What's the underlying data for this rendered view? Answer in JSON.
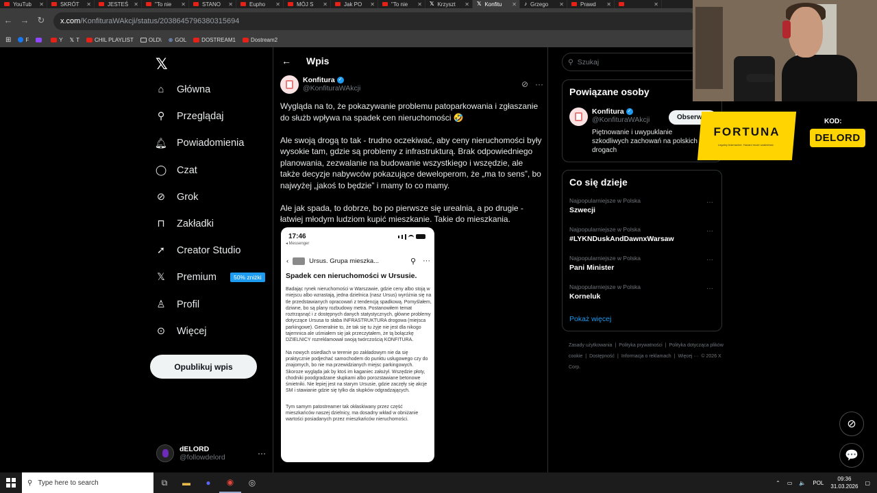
{
  "browser": {
    "tabs": [
      {
        "label": "YouTub",
        "icon": "youtube"
      },
      {
        "label": "SKRÓT",
        "icon": "youtube"
      },
      {
        "label": "JESTEŚ",
        "icon": "youtube"
      },
      {
        "label": "\"To nie",
        "icon": "youtube"
      },
      {
        "label": "STANO",
        "icon": "youtube"
      },
      {
        "label": "Eupho",
        "icon": "youtube"
      },
      {
        "label": "MÓJ S",
        "icon": "youtube"
      },
      {
        "label": "Jak PO",
        "icon": "youtube"
      },
      {
        "label": "\"To nie",
        "icon": "youtube"
      },
      {
        "label": "Krzyszt",
        "icon": "x"
      },
      {
        "label": "Konfitu",
        "icon": "x",
        "active": true
      },
      {
        "label": "Grzego",
        "icon": "tiktok"
      },
      {
        "label": "Prawd",
        "icon": "youtube"
      },
      {
        "label": "",
        "icon": "youtube"
      }
    ],
    "url_host": "x.com",
    "url_path": "/KonfituraWAkcji/status/2038645796380315694",
    "bookmarks": [
      {
        "label": "F",
        "icon": "facebook"
      },
      {
        "label": "",
        "icon": "twitch"
      },
      {
        "label": "Y",
        "icon": "youtube"
      },
      {
        "label": "T",
        "icon": "x"
      },
      {
        "label": "CHIL PLAYLIST",
        "icon": "youtube"
      },
      {
        "label": "OLD\\",
        "icon": "folder"
      },
      {
        "label": "GOL",
        "icon": "globe"
      },
      {
        "label": "DOSTREAM1",
        "icon": "youtube"
      },
      {
        "label": "Dostream2",
        "icon": "youtube"
      }
    ]
  },
  "sidebar": {
    "items": [
      {
        "label": "Główna",
        "icon": "home-icon"
      },
      {
        "label": "Przeglądaj",
        "icon": "search-icon"
      },
      {
        "label": "Powiadomienia",
        "icon": "bell-icon"
      },
      {
        "label": "Czat",
        "icon": "chat-icon"
      },
      {
        "label": "Grok",
        "icon": "grok-icon"
      },
      {
        "label": "Zakładki",
        "icon": "bookmark-icon"
      },
      {
        "label": "Creator Studio",
        "icon": "rocket-icon"
      },
      {
        "label": "Premium",
        "icon": "x-icon"
      },
      {
        "label": "Profil",
        "icon": "person-icon"
      },
      {
        "label": "Więcej",
        "icon": "more-icon"
      }
    ],
    "premium_badge": "50% zniżki",
    "post_button": "Opublikuj wpis",
    "account": {
      "name": "dELORD",
      "handle": "@followdelord"
    }
  },
  "main": {
    "header_title": "Wpis",
    "author_name": "Konfitura",
    "author_handle": "@KonfituraWAkcji",
    "paragraphs": [
      "Wygląda na to, że pokazywanie problemu patoparkowania i zgłaszanie do służb wpływa na spadek cen nieruchomości 🤣",
      "Ale swoją drogą to tak - trudno oczekiwać, aby ceny nieruchomości były wysokie tam, gdzie są problemy z infrastrukturą. Brak odpowiedniego planowania, zezwalanie na budowanie wszystkiego i wszędzie, ale także decyzje nabywców pokazujące deweloperom, że „ma to sens”, bo najwyżej „jakoś to będzie” i mamy to co mamy.",
      "Ale jak spada, to dobrze, bo po pierwsze się urealnia, a po drugie - łatwiej młodym ludziom kupić mieszkanie. Takie do mieszkania."
    ],
    "screenshot": {
      "time": "17:46",
      "back_app": "◂ Messenger",
      "group_name": "Ursus. Grupa mieszka...",
      "title": "Spadek cen nieruchomości w Ursusie.",
      "paragraphs": [
        "Badając rynek nieruchomości w Warszawie, gdzie ceny albo stoją w miejscu albo wzrastają, jedna dzielnica (nasz Ursus) wyróżnia się na tle przedstawianych opracowań z tendencją spadkową. Pomyślałem, dziwne, bo są plany rozbudowy metra. Postanowiłem temat roztrząsnąć i z dostępnych danych statystycznych, główne problemy dotyczące Ursusa to słaba INFRASTRUKTURA drogowa (miejsca parkingowe). Generalnie to, że tak się tu żyje nie jest dla nikogo tajemnica ale  uśmiałem się jak przeczytałem, że tą bolączkę DZIELNICY rozreklamował swoją twórczością KONFITURA.",
        "Na nowych osiedlach w terenie po zakładowym nie da się praktycznie podjechać samochodem do punktu usługowego czy do znajomych, bo nie ma przewidzianych miejsc parkingowych. Skoroze wygląda jak by ktoś im kaganiec założył. Wszędzie płoty, chodniki poodgradzane słupkami albo porozstawiane betonowe śmietniki. Nie lepiej jest na starym Ursusie, gdzie zaczęły się akcje SM i stawianie gdzie się tylko da słupków odgradzających.",
        "Tym samym patostreamer tak okłaskiwany przez część mieszkańców naszej dzielnicy, ma dosadny wkład w obniżanie wartości posiadanych przez mieszkańców nieruchomości."
      ]
    }
  },
  "right": {
    "search_placeholder": "Szukaj",
    "related_title": "Powiązane osoby",
    "related": {
      "name": "Konfitura",
      "handle": "@KonfituraWAkcji",
      "bio": "Piętnowanie i uwypuklanie szkodliwych zachowań na polskich drogach",
      "follow": "Obserwuj"
    },
    "trends_title": "Co się dzieje",
    "trends": [
      {
        "category": "Najpopularniejsze w Polska",
        "name": "Szwecji"
      },
      {
        "category": "Najpopularniejsze w Polska",
        "name": "#LYKNDuskAndDawnxWarsaw"
      },
      {
        "category": "Najpopularniejsze w Polska",
        "name": "Pani Minister"
      },
      {
        "category": "Najpopularniejsze w Polska",
        "name": "Korneluk"
      }
    ],
    "show_more": "Pokaż więcej",
    "footer": [
      "Zasady użytkowania",
      "Polityka prywatności",
      "Polityka dotycząca plików cookie",
      "Dostępność",
      "Informacja o reklamach",
      "Więcej ···",
      "© 2026 X Corp."
    ]
  },
  "overlay": {
    "sponsor": "FORTUNA",
    "sponsor_fineprint": "Legalny bukmacher. Hazard może uzależniać.",
    "code_label": "KOD:",
    "code_value": "DELORD"
  },
  "taskbar": {
    "search_placeholder": "Type here to search",
    "lang": "POL",
    "time": "09:36",
    "date": "31.03.2026"
  }
}
